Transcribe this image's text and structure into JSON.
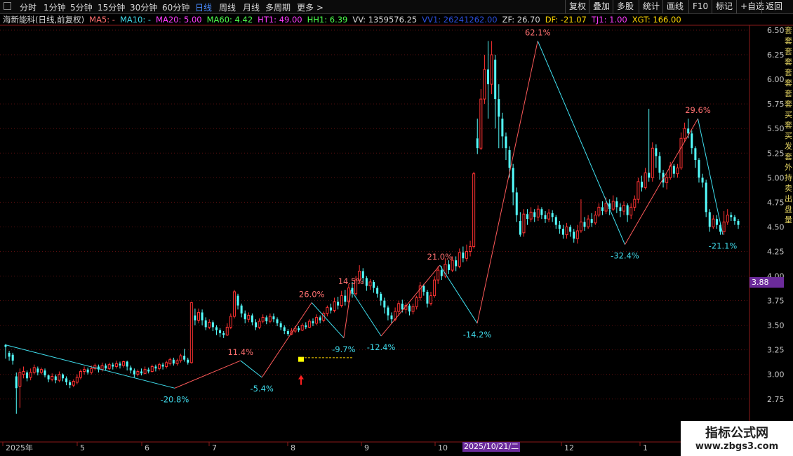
{
  "toolbar": {
    "periods": [
      "分时",
      "1分钟",
      "5分钟",
      "15分钟",
      "30分钟",
      "60分钟",
      "日线",
      "周线",
      "月线",
      "多周期",
      "更多 >"
    ],
    "active": "日线",
    "right": [
      "复权",
      "叠加",
      "多股",
      "统计",
      "画线",
      "F10",
      "标记",
      "+自选",
      "返回"
    ]
  },
  "indicators": [
    {
      "text": "海新能科(日线,前复权)",
      "color": "#d8d8d8"
    },
    {
      "text": "MA5: -",
      "color": "#ff6e6e"
    },
    {
      "text": "MA10: -",
      "color": "#3fd8e8"
    },
    {
      "text": "MA20: 5.00",
      "color": "#ff3cff"
    },
    {
      "text": "MA60: 4.42",
      "color": "#4dff4d"
    },
    {
      "text": "HT1: 49.00",
      "color": "#ff3cff"
    },
    {
      "text": "HH1: 6.39",
      "color": "#4dff4d"
    },
    {
      "text": "VV: 1359576.25",
      "color": "#d8d8d8"
    },
    {
      "text": "VV1: 26241262.00",
      "color": "#2a4fe0"
    },
    {
      "text": "ZF: 26.70",
      "color": "#d8d8d8"
    },
    {
      "text": "DF: -21.07",
      "color": "#ffd700"
    },
    {
      "text": "TJ1: 1.00",
      "color": "#ff3cff"
    },
    {
      "text": "XGT: 166.00",
      "color": "#ffd700"
    }
  ],
  "price_axis": [
    "6.50",
    "6.25",
    "6.00",
    "5.75",
    "5.50",
    "5.25",
    "5.00",
    "4.75",
    "4.50",
    "4.25",
    "4.00",
    "3.75",
    "3.50",
    "3.25",
    "3.00",
    "2.75"
  ],
  "current_price_tag": "3.88",
  "date_axis": [
    "2025年",
    "5",
    "6",
    "7",
    "8",
    "9",
    "10",
    "12",
    "1"
  ],
  "date_cursor": "2025/10/21/二",
  "right_edge_chars": [
    "套",
    "套",
    "套",
    "套",
    "套",
    "套",
    "套",
    "套",
    "买",
    "套",
    "买",
    "发",
    "套",
    "外",
    "持",
    "卖",
    "出",
    "盘",
    "量"
  ],
  "watermark": {
    "line1": "指标公式网",
    "line2": "www.zbgs3.com"
  },
  "zigzag": {
    "labels": [
      {
        "text": "-20.8%",
        "dir": "down"
      },
      {
        "text": "11.4%",
        "dir": "up"
      },
      {
        "text": "-5.4%",
        "dir": "down"
      },
      {
        "text": "26.0%",
        "dir": "up"
      },
      {
        "text": "-9.7%",
        "dir": "down"
      },
      {
        "text": "14.5%",
        "dir": "up"
      },
      {
        "text": "-12.4%",
        "dir": "down"
      },
      {
        "text": "21.0%",
        "dir": "up"
      },
      {
        "text": "-14.2%",
        "dir": "down"
      },
      {
        "text": "62.1%",
        "dir": "up"
      },
      {
        "text": "-32.4%",
        "dir": "down"
      },
      {
        "text": "29.6%",
        "dir": "up"
      },
      {
        "text": "-21.1%",
        "dir": "down"
      }
    ],
    "pivots": [
      {
        "date": "2025-01-02",
        "price": 3.3
      },
      {
        "date": "2025-04-07",
        "price": 2.86
      },
      {
        "date": "2025-05-14",
        "price": 3.14
      },
      {
        "date": "2025-05-26",
        "price": 2.97
      },
      {
        "date": "2025-06-23",
        "price": 3.73
      },
      {
        "date": "2025-07-11",
        "price": 3.37
      },
      {
        "date": "2025-07-15",
        "price": 3.86
      },
      {
        "date": "2025-08-01",
        "price": 3.39
      },
      {
        "date": "2025-09-03",
        "price": 4.11
      },
      {
        "date": "2025-09-24",
        "price": 3.52
      },
      {
        "date": "2025-10-28",
        "price": 6.39
      },
      {
        "date": "2025-12-16",
        "price": 4.32
      },
      {
        "date": "2026-01-26",
        "price": 5.6
      },
      {
        "date": "2026-02-09",
        "price": 4.42
      }
    ]
  },
  "signals": {
    "buy_date": "2025-06-17",
    "buy_price": 3.15,
    "support_price": 3.17
  },
  "candles": [
    [
      3.3,
      3.28,
      3.31,
      3.16
    ],
    [
      3.22,
      3.18,
      3.24,
      3.14
    ],
    [
      3.2,
      3.14,
      3.22,
      3.1
    ],
    [
      2.98,
      2.86,
      3.02,
      2.6
    ],
    [
      2.88,
      3.02,
      3.06,
      2.66
    ],
    [
      3.0,
      3.03,
      3.08,
      2.96
    ],
    [
      3.02,
      2.96,
      3.04,
      2.93
    ],
    [
      2.97,
      3.02,
      3.06,
      2.94
    ],
    [
      3.02,
      3.07,
      3.1,
      3.0
    ],
    [
      3.06,
      3.02,
      3.08,
      2.99
    ],
    [
      3.02,
      3.05,
      3.07,
      3.0
    ],
    [
      3.04,
      2.99,
      3.06,
      2.97
    ],
    [
      2.99,
      2.95,
      3.0,
      2.92
    ],
    [
      2.95,
      2.98,
      3.01,
      2.93
    ],
    [
      2.98,
      2.94,
      3.0,
      2.91
    ],
    [
      2.94,
      3.0,
      3.03,
      2.92
    ],
    [
      3.0,
      2.96,
      3.01,
      2.93
    ],
    [
      2.96,
      2.92,
      2.98,
      2.89
    ],
    [
      2.92,
      2.89,
      2.94,
      2.86
    ],
    [
      2.89,
      2.93,
      2.95,
      2.87
    ],
    [
      2.92,
      2.97,
      3.0,
      2.9
    ],
    [
      2.97,
      3.03,
      3.05,
      2.95
    ],
    [
      3.03,
      3.05,
      3.08,
      3.0
    ],
    [
      3.05,
      3.02,
      3.07,
      3.0
    ],
    [
      3.02,
      3.06,
      3.09,
      3.0
    ],
    [
      3.06,
      3.09,
      3.11,
      3.04
    ],
    [
      3.08,
      3.05,
      3.1,
      3.02
    ],
    [
      3.05,
      3.09,
      3.12,
      3.03
    ],
    [
      3.09,
      3.06,
      3.11,
      3.04
    ],
    [
      3.06,
      3.1,
      3.12,
      3.04
    ],
    [
      3.1,
      3.08,
      3.12,
      3.05
    ],
    [
      3.08,
      3.11,
      3.14,
      3.06
    ],
    [
      3.11,
      3.09,
      3.13,
      3.06
    ],
    [
      3.09,
      3.13,
      3.14,
      3.07
    ],
    [
      3.13,
      3.08,
      3.14,
      3.04
    ],
    [
      3.07,
      3.04,
      3.09,
      3.01
    ],
    [
      3.04,
      3.0,
      3.06,
      2.97
    ],
    [
      3.0,
      3.03,
      3.05,
      2.98
    ],
    [
      3.03,
      3.01,
      3.06,
      2.99
    ],
    [
      3.01,
      3.05,
      3.08,
      3.0
    ],
    [
      3.05,
      3.03,
      3.07,
      3.01
    ],
    [
      3.03,
      3.08,
      3.1,
      3.02
    ],
    [
      3.08,
      3.06,
      3.1,
      3.03
    ],
    [
      3.06,
      3.1,
      3.12,
      3.04
    ],
    [
      3.1,
      3.08,
      3.12,
      3.05
    ],
    [
      3.08,
      3.12,
      3.14,
      3.06
    ],
    [
      3.11,
      3.15,
      3.17,
      3.09
    ],
    [
      3.15,
      3.11,
      3.17,
      3.09
    ],
    [
      3.11,
      3.14,
      3.16,
      3.09
    ],
    [
      3.14,
      3.19,
      3.21,
      3.12
    ],
    [
      3.19,
      3.15,
      3.26,
      3.13
    ],
    [
      3.15,
      3.12,
      3.17,
      3.1
    ],
    [
      3.12,
      3.73,
      3.74,
      3.11
    ],
    [
      3.6,
      3.55,
      3.67,
      3.5
    ],
    [
      3.55,
      3.63,
      3.67,
      3.52
    ],
    [
      3.63,
      3.55,
      3.66,
      3.5
    ],
    [
      3.55,
      3.48,
      3.58,
      3.45
    ],
    [
      3.48,
      3.53,
      3.56,
      3.46
    ],
    [
      3.53,
      3.48,
      3.55,
      3.44
    ],
    [
      3.48,
      3.45,
      3.5,
      3.4
    ],
    [
      3.45,
      3.42,
      3.47,
      3.38
    ],
    [
      3.42,
      3.4,
      3.44,
      3.37
    ],
    [
      3.4,
      3.48,
      3.52,
      3.39
    ],
    [
      3.48,
      3.59,
      3.62,
      3.46
    ],
    [
      3.59,
      3.84,
      3.86,
      3.57
    ],
    [
      3.8,
      3.7,
      3.82,
      3.66
    ],
    [
      3.7,
      3.62,
      3.72,
      3.58
    ],
    [
      3.62,
      3.56,
      3.65,
      3.52
    ],
    [
      3.56,
      3.6,
      3.63,
      3.53
    ],
    [
      3.6,
      3.53,
      3.62,
      3.5
    ],
    [
      3.53,
      3.48,
      3.56,
      3.45
    ],
    [
      3.48,
      3.54,
      3.57,
      3.46
    ],
    [
      3.54,
      3.58,
      3.61,
      3.52
    ],
    [
      3.58,
      3.54,
      3.6,
      3.51
    ],
    [
      3.54,
      3.59,
      3.62,
      3.52
    ],
    [
      3.59,
      3.56,
      3.62,
      3.53
    ],
    [
      3.56,
      3.52,
      3.58,
      3.49
    ],
    [
      3.52,
      3.48,
      3.54,
      3.45
    ],
    [
      3.48,
      3.44,
      3.5,
      3.41
    ],
    [
      3.44,
      3.41,
      3.46,
      3.39
    ],
    [
      3.41,
      3.44,
      3.47,
      3.4
    ],
    [
      3.44,
      3.47,
      3.49,
      3.42
    ],
    [
      3.47,
      3.45,
      3.49,
      3.43
    ],
    [
      3.45,
      3.5,
      3.52,
      3.44
    ],
    [
      3.5,
      3.48,
      3.53,
      3.46
    ],
    [
      3.48,
      3.54,
      3.56,
      3.47
    ],
    [
      3.54,
      3.52,
      3.57,
      3.49
    ],
    [
      3.52,
      3.58,
      3.61,
      3.5
    ],
    [
      3.58,
      3.55,
      3.6,
      3.52
    ],
    [
      3.55,
      3.62,
      3.64,
      3.53
    ],
    [
      3.62,
      3.68,
      3.7,
      3.59
    ],
    [
      3.68,
      3.65,
      3.72,
      3.62
    ],
    [
      3.65,
      3.74,
      3.78,
      3.63
    ],
    [
      3.74,
      3.7,
      3.79,
      3.66
    ],
    [
      3.7,
      3.8,
      3.85,
      3.68
    ],
    [
      3.8,
      3.74,
      3.86,
      3.7
    ],
    [
      3.74,
      3.88,
      3.92,
      3.72
    ],
    [
      3.88,
      3.82,
      3.94,
      3.78
    ],
    [
      3.82,
      3.96,
      4.0,
      3.8
    ],
    [
      3.96,
      4.05,
      4.11,
      3.92
    ],
    [
      4.05,
      3.98,
      4.08,
      3.92
    ],
    [
      3.98,
      3.9,
      4.0,
      3.85
    ],
    [
      3.9,
      3.94,
      3.97,
      3.86
    ],
    [
      3.94,
      3.88,
      3.96,
      3.83
    ],
    [
      3.88,
      3.82,
      3.9,
      3.78
    ],
    [
      3.82,
      3.75,
      3.84,
      3.7
    ],
    [
      3.75,
      3.68,
      3.78,
      3.62
    ],
    [
      3.68,
      3.6,
      3.7,
      3.55
    ],
    [
      3.6,
      3.56,
      3.63,
      3.52
    ],
    [
      3.56,
      3.64,
      3.68,
      3.54
    ],
    [
      3.64,
      3.72,
      3.75,
      3.6
    ],
    [
      3.72,
      3.66,
      3.76,
      3.63
    ],
    [
      3.66,
      3.7,
      3.73,
      3.62
    ],
    [
      3.7,
      3.64,
      3.72,
      3.6
    ],
    [
      3.64,
      3.69,
      3.72,
      3.61
    ],
    [
      3.69,
      3.78,
      3.8,
      3.66
    ],
    [
      3.78,
      3.9,
      3.94,
      3.75
    ],
    [
      3.9,
      3.84,
      3.92,
      3.8
    ],
    [
      3.84,
      3.72,
      3.86,
      3.68
    ],
    [
      3.72,
      3.8,
      3.84,
      3.7
    ],
    [
      3.8,
      3.96,
      4.0,
      3.78
    ],
    [
      3.96,
      4.06,
      4.1,
      3.92
    ],
    [
      4.06,
      4.0,
      4.1,
      3.96
    ],
    [
      4.0,
      4.12,
      4.18,
      3.98
    ],
    [
      4.12,
      4.06,
      4.16,
      4.02
    ],
    [
      4.06,
      4.16,
      4.2,
      4.04
    ],
    [
      4.16,
      4.1,
      4.2,
      4.05
    ],
    [
      4.1,
      4.24,
      4.28,
      4.08
    ],
    [
      4.24,
      4.18,
      4.3,
      4.14
    ],
    [
      4.18,
      4.25,
      4.32,
      4.15
    ],
    [
      4.25,
      4.3,
      4.36,
      4.2
    ],
    [
      4.3,
      5.04,
      5.06,
      4.28
    ],
    [
      5.4,
      5.3,
      5.6,
      5.24
    ],
    [
      5.3,
      5.8,
      5.9,
      5.28
    ],
    [
      5.8,
      6.1,
      6.25,
      5.75
    ],
    [
      6.1,
      5.95,
      6.39,
      5.6
    ],
    [
      5.95,
      6.25,
      6.39,
      5.85
    ],
    [
      6.2,
      5.8,
      6.25,
      5.5
    ],
    [
      5.8,
      5.62,
      5.95,
      5.3
    ],
    [
      5.6,
      5.42,
      5.66,
      5.3
    ],
    [
      5.42,
      5.3,
      5.46,
      5.18
    ],
    [
      5.28,
      5.1,
      5.32,
      5.0
    ],
    [
      5.1,
      4.85,
      5.14,
      4.72
    ],
    [
      4.85,
      4.62,
      4.9,
      4.55
    ],
    [
      4.56,
      4.42,
      4.65,
      4.4
    ],
    [
      4.44,
      4.63,
      4.68,
      4.4
    ],
    [
      4.63,
      4.58,
      4.68,
      4.52
    ],
    [
      4.58,
      4.65,
      4.7,
      4.55
    ],
    [
      4.65,
      4.6,
      4.68,
      4.55
    ],
    [
      4.6,
      4.68,
      4.72,
      4.56
    ],
    [
      4.68,
      4.62,
      4.7,
      4.58
    ],
    [
      4.62,
      4.58,
      4.66,
      4.54
    ],
    [
      4.58,
      4.64,
      4.68,
      4.55
    ],
    [
      4.64,
      4.6,
      4.67,
      4.55
    ],
    [
      4.6,
      4.52,
      4.62,
      4.48
    ],
    [
      4.52,
      4.48,
      4.56,
      4.43
    ],
    [
      4.48,
      4.42,
      4.52,
      4.38
    ],
    [
      4.42,
      4.5,
      4.54,
      4.38
    ],
    [
      4.5,
      4.45,
      4.52,
      4.4
    ],
    [
      4.45,
      4.38,
      4.48,
      4.34
    ],
    [
      4.38,
      4.46,
      4.52,
      4.33
    ],
    [
      4.46,
      4.55,
      4.78,
      4.44
    ],
    [
      4.55,
      4.5,
      4.6,
      4.46
    ],
    [
      4.5,
      4.58,
      4.62,
      4.48
    ],
    [
      4.58,
      4.54,
      4.64,
      4.5
    ],
    [
      4.54,
      4.62,
      4.66,
      4.52
    ],
    [
      4.62,
      4.7,
      4.74,
      4.6
    ],
    [
      4.7,
      4.66,
      4.76,
      4.62
    ],
    [
      4.66,
      4.74,
      4.8,
      4.63
    ],
    [
      4.74,
      4.68,
      4.78,
      4.62
    ],
    [
      4.68,
      4.76,
      4.82,
      4.66
    ],
    [
      4.76,
      4.7,
      4.8,
      4.64
    ],
    [
      4.7,
      4.66,
      4.74,
      4.6
    ],
    [
      4.66,
      4.72,
      4.76,
      4.62
    ],
    [
      4.72,
      4.62,
      4.74,
      4.55
    ],
    [
      4.62,
      4.7,
      4.74,
      4.58
    ],
    [
      4.7,
      4.78,
      4.82,
      4.66
    ],
    [
      4.78,
      4.96,
      5.0,
      4.74
    ],
    [
      4.96,
      4.9,
      5.02,
      4.86
    ],
    [
      4.9,
      5.05,
      5.1,
      4.88
    ],
    [
      5.05,
      5.0,
      5.7,
      4.96
    ],
    [
      5.0,
      5.3,
      5.36,
      4.96
    ],
    [
      5.3,
      5.22,
      5.34,
      5.1
    ],
    [
      5.22,
      5.05,
      5.26,
      4.98
    ],
    [
      5.05,
      4.95,
      5.08,
      4.9
    ],
    [
      4.95,
      5.0,
      5.04,
      4.88
    ],
    [
      5.0,
      5.12,
      5.16,
      4.98
    ],
    [
      5.12,
      5.04,
      5.14,
      5.0
    ],
    [
      5.04,
      5.1,
      5.14,
      5.0
    ],
    [
      5.1,
      5.4,
      5.46,
      5.08
    ],
    [
      5.4,
      5.5,
      5.56,
      5.36
    ],
    [
      5.5,
      5.45,
      5.6,
      5.4
    ],
    [
      5.45,
      5.3,
      5.48,
      5.24
    ],
    [
      5.3,
      5.18,
      5.32,
      5.1
    ],
    [
      5.18,
      5.0,
      5.2,
      4.95
    ],
    [
      5.0,
      4.95,
      5.04,
      4.9
    ],
    [
      4.95,
      4.65,
      4.98,
      4.6
    ],
    [
      4.65,
      4.5,
      4.68,
      4.45
    ],
    [
      4.5,
      4.58,
      4.62,
      4.48
    ],
    [
      4.58,
      4.52,
      4.62,
      4.48
    ],
    [
      4.52,
      4.45,
      4.54,
      4.42
    ],
    [
      4.45,
      4.55,
      4.66,
      4.42
    ],
    [
      4.55,
      4.62,
      4.68,
      4.52
    ],
    [
      4.62,
      4.6,
      4.65,
      4.56
    ],
    [
      4.6,
      4.56,
      4.62,
      4.52
    ],
    [
      4.56,
      4.52,
      4.58,
      4.48
    ]
  ]
}
